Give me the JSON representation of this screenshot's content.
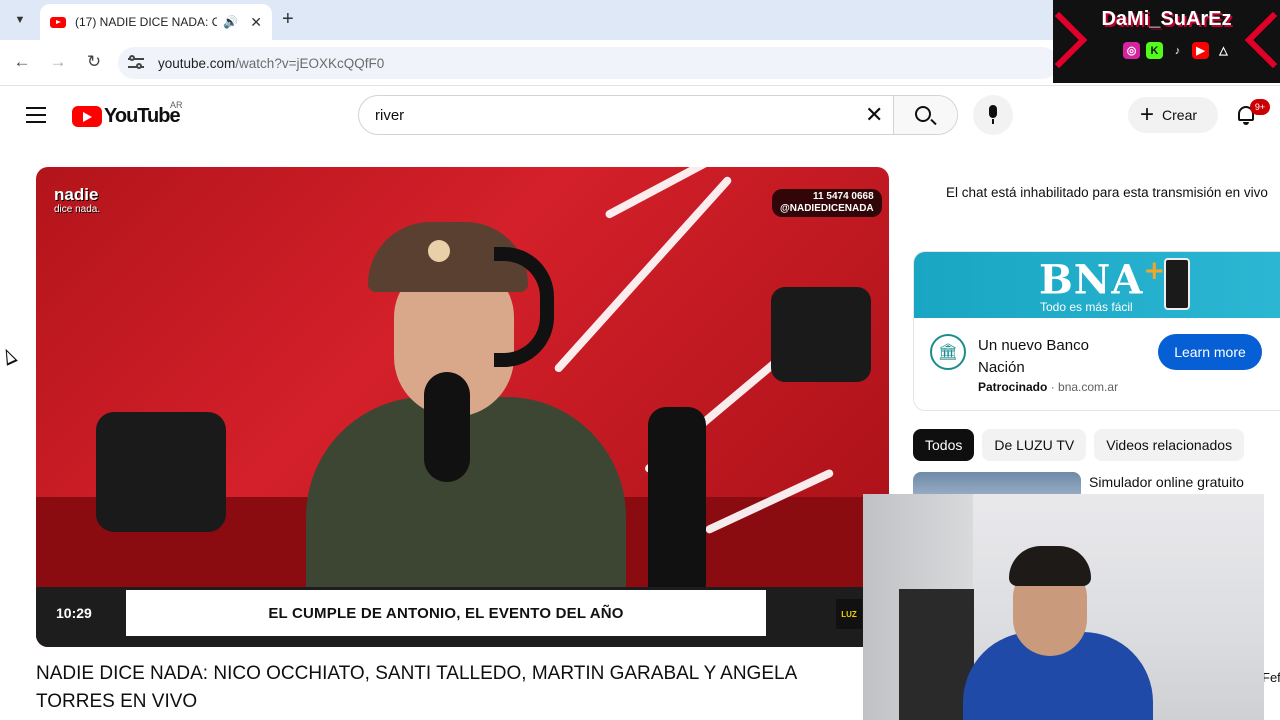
{
  "browser": {
    "tab_title": "(17) NADIE DICE NADA: OC",
    "url_host": "youtube.com",
    "url_path": "/watch?v=jEOXKcQQfF0"
  },
  "youtube": {
    "logo_text": "YouTube",
    "country_code": "AR",
    "search_value": "river",
    "create_label": "Crear",
    "notification_count": "9+"
  },
  "player": {
    "brand_line1": "nadie",
    "brand_line2": "dice nada.",
    "phone_tag": "11 5474 0668",
    "handle_tag": "@NADIEDICENADA",
    "timecode": "10:29",
    "lower_third": "EL CUMPLE DE ANTONIO, EL EVENTO DEL AÑO",
    "corner_logo": "LUZ"
  },
  "video": {
    "title": "NADIE DICE NADA: NICO OCCHIATO, SANTI TALLEDO, MARTIN GARABAL Y ANGELA TORRES EN VIVO"
  },
  "sidebar": {
    "chat_disabled": "El chat está inhabilitado para esta transmisión en vivo",
    "ad": {
      "brand": "BNA",
      "tagline": "Todo es más fácil",
      "title": "Un nuevo Banco Nación",
      "sponsored": "Patrocinado",
      "domain": "bna.com.ar",
      "cta": "Learn more"
    },
    "chips": [
      "Todos",
      "De LUZU TV",
      "Videos relacionados"
    ],
    "rec_title": "Simulador online gratuito",
    "rec_fragment": "Fef"
  },
  "overlay": {
    "streamer_name": "DaMi_SuArEz"
  },
  "colors": {
    "yt_red": "#ff0000",
    "link_blue": "#065fd4",
    "bna_cyan": "#19a6c3"
  }
}
